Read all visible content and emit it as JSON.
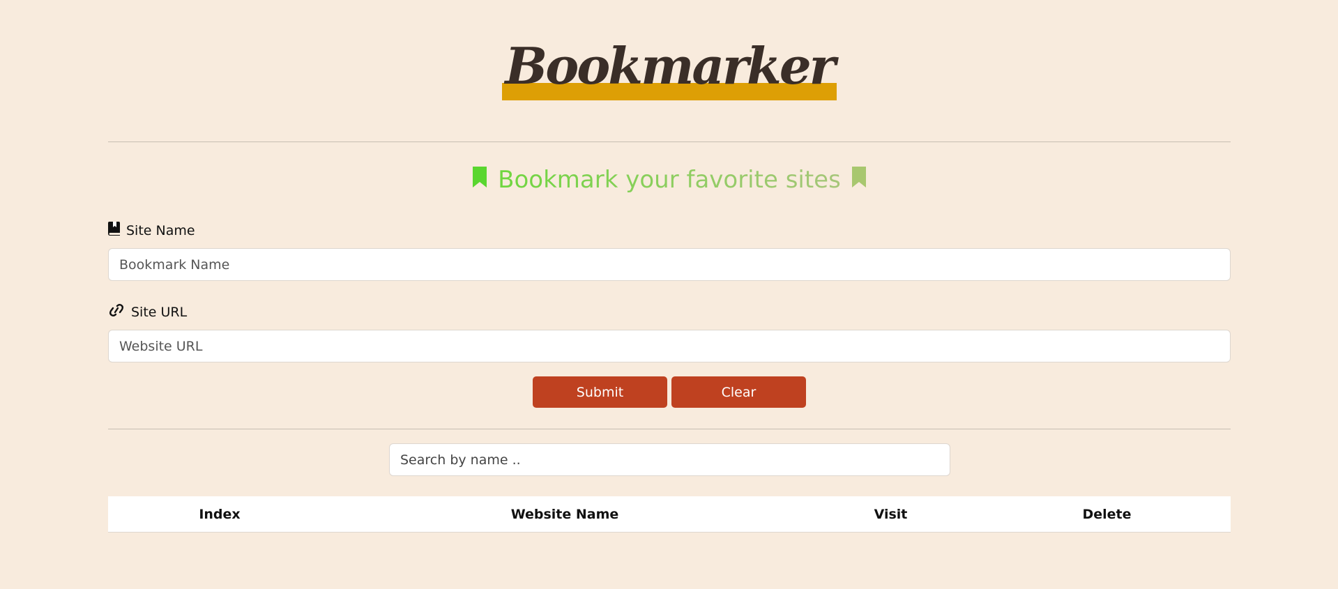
{
  "brand": {
    "title": "Bookmarker"
  },
  "header": {
    "tagline": "Bookmark your favorite sites"
  },
  "form": {
    "site_name": {
      "label": "Site Name",
      "placeholder": "Bookmark Name",
      "value": ""
    },
    "site_url": {
      "label": "Site URL",
      "placeholder": "Website URL",
      "value": ""
    },
    "submit_label": "Submit",
    "clear_label": "Clear"
  },
  "search": {
    "placeholder": "Search by name ..",
    "value": ""
  },
  "table": {
    "columns": [
      "Index",
      "Website Name",
      "Visit",
      "Delete"
    ],
    "rows": []
  },
  "colors": {
    "background": "#f8ebdd",
    "brand_highlight": "#dd9f05",
    "brand_text": "#3a2e28",
    "tagline_start": "#6fd63f",
    "tagline_end": "#a6c679",
    "button": "#bf4120",
    "button_text": "#ffffff"
  },
  "icons": {
    "tagline_left": "bookmark-icon",
    "tagline_right": "bookmark-icon",
    "site_name": "book-bookmark-icon",
    "site_url": "link-icon"
  }
}
